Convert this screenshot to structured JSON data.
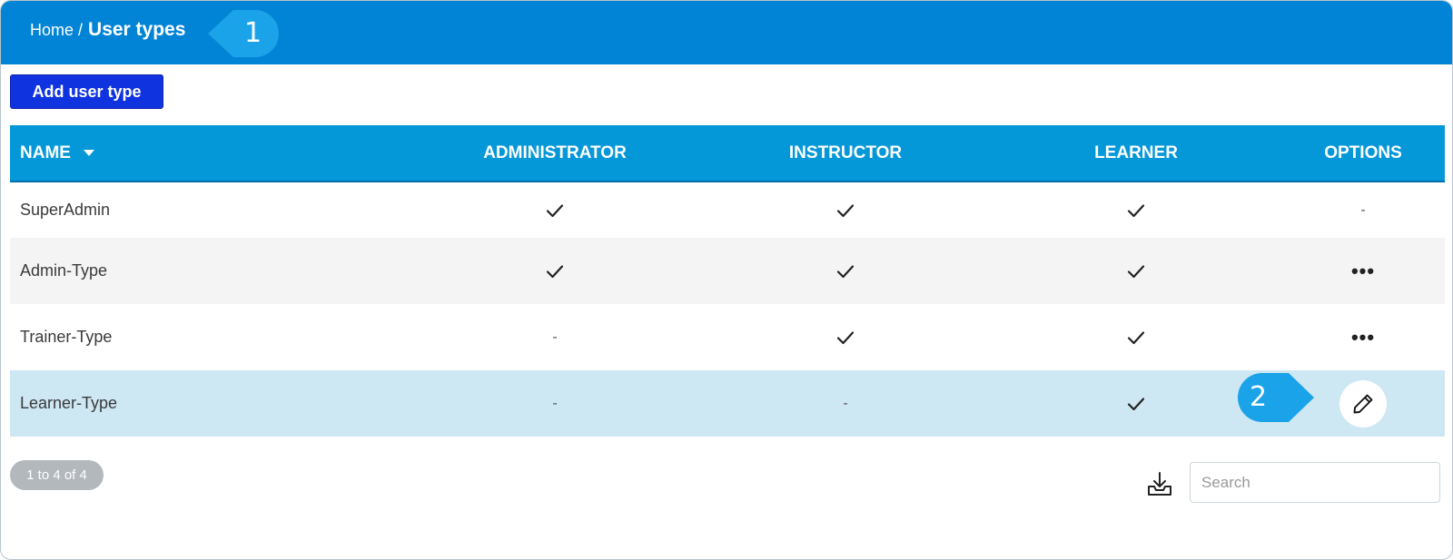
{
  "breadcrumb": {
    "home": "Home",
    "separator": "/",
    "current": "User types"
  },
  "callouts": {
    "first": "1",
    "second": "2"
  },
  "toolbar": {
    "add_label": "Add user type"
  },
  "table": {
    "headers": {
      "name": "NAME",
      "administrator": "ADMINISTRATOR",
      "instructor": "INSTRUCTOR",
      "learner": "LEARNER",
      "options": "OPTIONS"
    },
    "sort": {
      "column": "name",
      "direction": "descending-caret"
    },
    "rows": [
      {
        "name": "SuperAdmin",
        "administrator": "check",
        "instructor": "check",
        "learner": "check",
        "options": "-"
      },
      {
        "name": "Admin-Type",
        "administrator": "check",
        "instructor": "check",
        "learner": "check",
        "options": "more"
      },
      {
        "name": "Trainer-Type",
        "administrator": "-",
        "instructor": "check",
        "learner": "check",
        "options": "more"
      },
      {
        "name": "Learner-Type",
        "administrator": "-",
        "instructor": "-",
        "learner": "check",
        "options": "edit"
      }
    ],
    "dash": "-",
    "more_label": "•••"
  },
  "footer": {
    "pagination": "1 to 4 of 4",
    "search_placeholder": "Search"
  },
  "colors": {
    "header_bar": "#0284d6",
    "table_header": "#0598d8",
    "add_button": "#1033e0",
    "callout": "#1aa3e8",
    "selected_row": "#cde7f3"
  },
  "icons": {
    "check": "check-icon",
    "more": "more-icon",
    "edit": "pencil-icon",
    "download": "download-icon",
    "sort": "caret-down-icon"
  }
}
